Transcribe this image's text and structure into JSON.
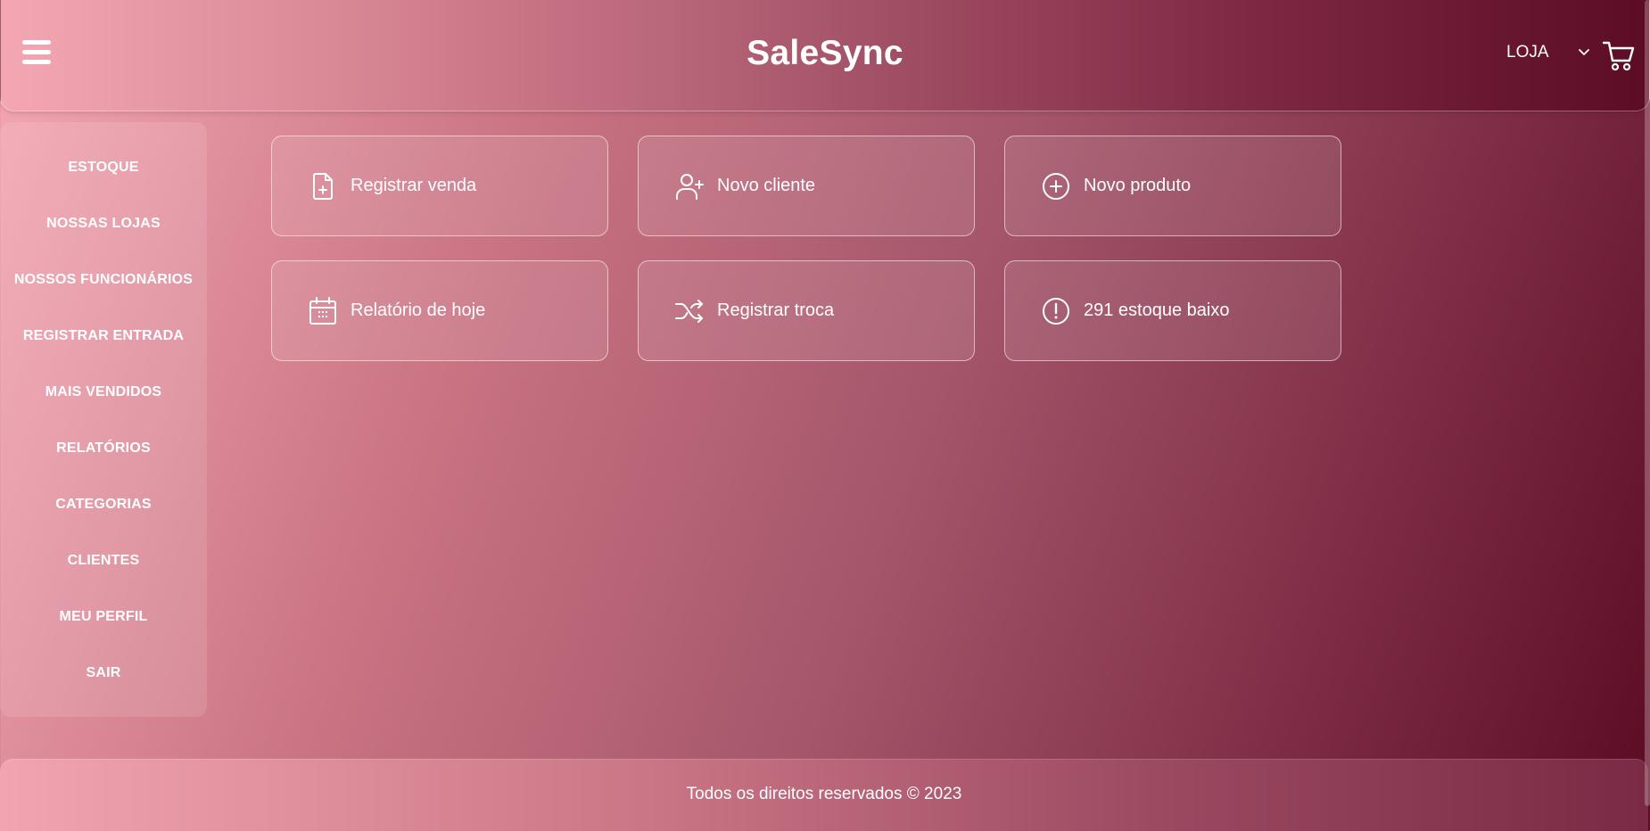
{
  "header": {
    "title": "SaleSync",
    "store_select": "LOJA"
  },
  "sidebar": {
    "items": [
      {
        "label": "ESTOQUE"
      },
      {
        "label": "NOSSAS LOJAS"
      },
      {
        "label": "NOSSOS FUNCIONÁRIOS"
      },
      {
        "label": "REGISTRAR ENTRADA"
      },
      {
        "label": "MAIS VENDIDOS"
      },
      {
        "label": "RELATÓRIOS"
      },
      {
        "label": "CATEGORIAS"
      },
      {
        "label": "CLIENTES"
      },
      {
        "label": "MEU PERFIL"
      },
      {
        "label": "SAIR"
      }
    ]
  },
  "actions": [
    {
      "label": "Registrar venda",
      "icon": "file-plus-icon"
    },
    {
      "label": "Novo cliente",
      "icon": "user-plus-icon"
    },
    {
      "label": "Novo produto",
      "icon": "plus-circle-icon"
    },
    {
      "label": "Relatório de hoje",
      "icon": "calendar-icon"
    },
    {
      "label": "Registrar troca",
      "icon": "shuffle-icon"
    },
    {
      "label": "291 estoque baixo",
      "icon": "alert-circle-icon"
    }
  ],
  "footer": {
    "text": "Todos os direitos reservados © 2023"
  }
}
